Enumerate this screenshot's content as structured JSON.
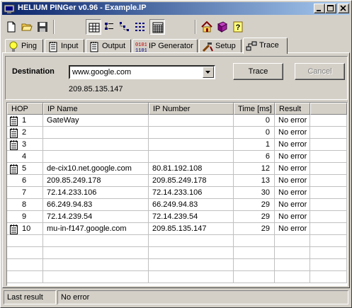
{
  "window": {
    "title": "HELIUM PINGer  v0.96  -  Example.IP"
  },
  "toolbar": {
    "buttons": [
      "new-icon",
      "open-icon",
      "save-icon",
      "grid-view-icon",
      "list-view-icon",
      "tree-view-icon",
      "details-view-icon",
      "columns-view-icon",
      "home-icon",
      "book-icon",
      "help-icon"
    ]
  },
  "tabs": [
    {
      "label": "Ping",
      "icon": "bulb-icon"
    },
    {
      "label": "Input",
      "icon": "notepad-icon"
    },
    {
      "label": "Output",
      "icon": "notepad-icon"
    },
    {
      "label": "IP Generator",
      "icon": "binary-icon"
    },
    {
      "label": "Setup",
      "icon": "tools-icon"
    },
    {
      "label": "Trace",
      "icon": "network-icon",
      "active": true
    }
  ],
  "trace": {
    "destination_label": "Destination",
    "destination_value": "www.google.com",
    "resolved_ip": "209.85.135.147",
    "trace_label": "Trace",
    "cancel_label": "Cancel"
  },
  "table": {
    "columns": [
      "HOP",
      "IP Name",
      "IP Number",
      "Time [ms]",
      "Result"
    ],
    "rows": [
      {
        "hop": "1",
        "name": "GateWay",
        "ip": "",
        "time": "0",
        "result": "No error",
        "icon": true
      },
      {
        "hop": "2",
        "name": "",
        "ip": "",
        "time": "0",
        "result": "No error",
        "icon": true
      },
      {
        "hop": "3",
        "name": "",
        "ip": "",
        "time": "1",
        "result": "No error",
        "icon": true
      },
      {
        "hop": "4",
        "name": "",
        "ip": "",
        "time": "6",
        "result": "No error",
        "icon": false
      },
      {
        "hop": "5",
        "name": "de-cix10.net.google.com",
        "ip": "80.81.192.108",
        "time": "12",
        "result": "No error",
        "icon": true
      },
      {
        "hop": "6",
        "name": "209.85.249.178",
        "ip": "209.85.249.178",
        "time": "13",
        "result": "No error",
        "icon": false
      },
      {
        "hop": "7",
        "name": "72.14.233.106",
        "ip": "72.14.233.106",
        "time": "30",
        "result": "No error",
        "icon": false
      },
      {
        "hop": "8",
        "name": "66.249.94.83",
        "ip": "66.249.94.83",
        "time": "29",
        "result": "No error",
        "icon": false
      },
      {
        "hop": "9",
        "name": "72.14.239.54",
        "ip": "72.14.239.54",
        "time": "29",
        "result": "No error",
        "icon": false
      },
      {
        "hop": "10",
        "name": "mu-in-f147.google.com",
        "ip": "209.85.135.147",
        "time": "29",
        "result": "No error",
        "icon": true
      }
    ]
  },
  "status": {
    "label": "Last result",
    "value": "No error"
  },
  "colors": {
    "title_start": "#0a246a",
    "title_end": "#a6caf0",
    "face": "#d4d0c8"
  }
}
